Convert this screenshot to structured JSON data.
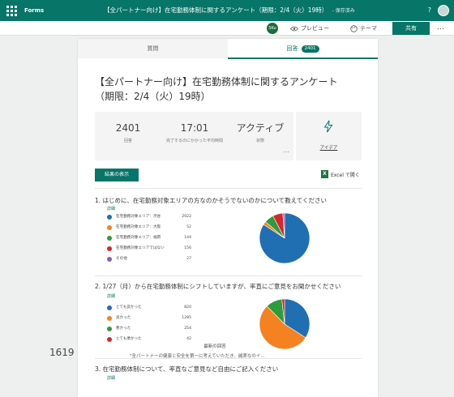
{
  "topbar": {
    "app_name": "Forms",
    "doc_title": "【全パートナー向け】在宅勤務体制に関するアンケート（期限：2/4（火）19時）",
    "saved": "- 保存済み",
    "help": "?",
    "colors": {
      "accent": "#077568"
    }
  },
  "cmdbar": {
    "avatar_initials": "SKu",
    "preview": "プレビュー",
    "theme": "テーマ",
    "share": "共有",
    "more": "…"
  },
  "tabs": {
    "questions": "質問",
    "responses": "回答",
    "responses_badge": "2401"
  },
  "survey": {
    "title": "【全パートナー向け】在宅勤務体制に関するアンケート（期限：2/4（火）19時）",
    "stats": {
      "responses_value": "2401",
      "responses_label": "回答",
      "avg_time_value": "17:01",
      "avg_time_label": "完了するのにかかった平均時間",
      "status_value": "アクティブ",
      "status_label": "状態",
      "more": "…",
      "ideas_label": "アイデア"
    },
    "view_results": "結果の表示",
    "excel_label": "Excel で開く",
    "excel_icon": "X"
  },
  "questions": [
    {
      "title": "1. はじめに、在宅勤務対象エリアの方なのかそうでないのかについて教えてください",
      "details": "詳細",
      "options": [
        {
          "label": "在宅勤務対象エリア：渋谷",
          "count": 2022,
          "color": "#1f6fb2"
        },
        {
          "label": "在宅勤務対象エリア：大阪",
          "count": 52,
          "color": "#f58220"
        },
        {
          "label": "在宅勤務対象エリア：福岡",
          "count": 144,
          "color": "#2e9b3c"
        },
        {
          "label": "在宅勤務対象エリアではない",
          "count": 156,
          "color": "#d7262b"
        },
        {
          "label": "その他",
          "count": 27,
          "color": "#8a5bb8"
        }
      ]
    },
    {
      "title": "2. 1/27（月）から在宅勤務体制にシフトしていますが、率直にご意見をお聞かせください",
      "details": "詳細",
      "options": [
        {
          "label": "とても良かった",
          "count": 820,
          "color": "#1f6fb2"
        },
        {
          "label": "良かった",
          "count": 1285,
          "color": "#f58220"
        },
        {
          "label": "悪かった",
          "count": 254,
          "color": "#2e9b3c"
        },
        {
          "label": "とても悪かった",
          "count": 42,
          "color": "#d7262b"
        }
      ]
    },
    {
      "title": "3. 在宅勤務体制について、率直なご意見など自由にご記入ください",
      "details": "詳細",
      "response_count": "1619",
      "latest_header": "最新の回答",
      "latest_text": "\"全パートナーの健康と安全を第一に考えていただき、誠実なのイ..."
    }
  ]
}
